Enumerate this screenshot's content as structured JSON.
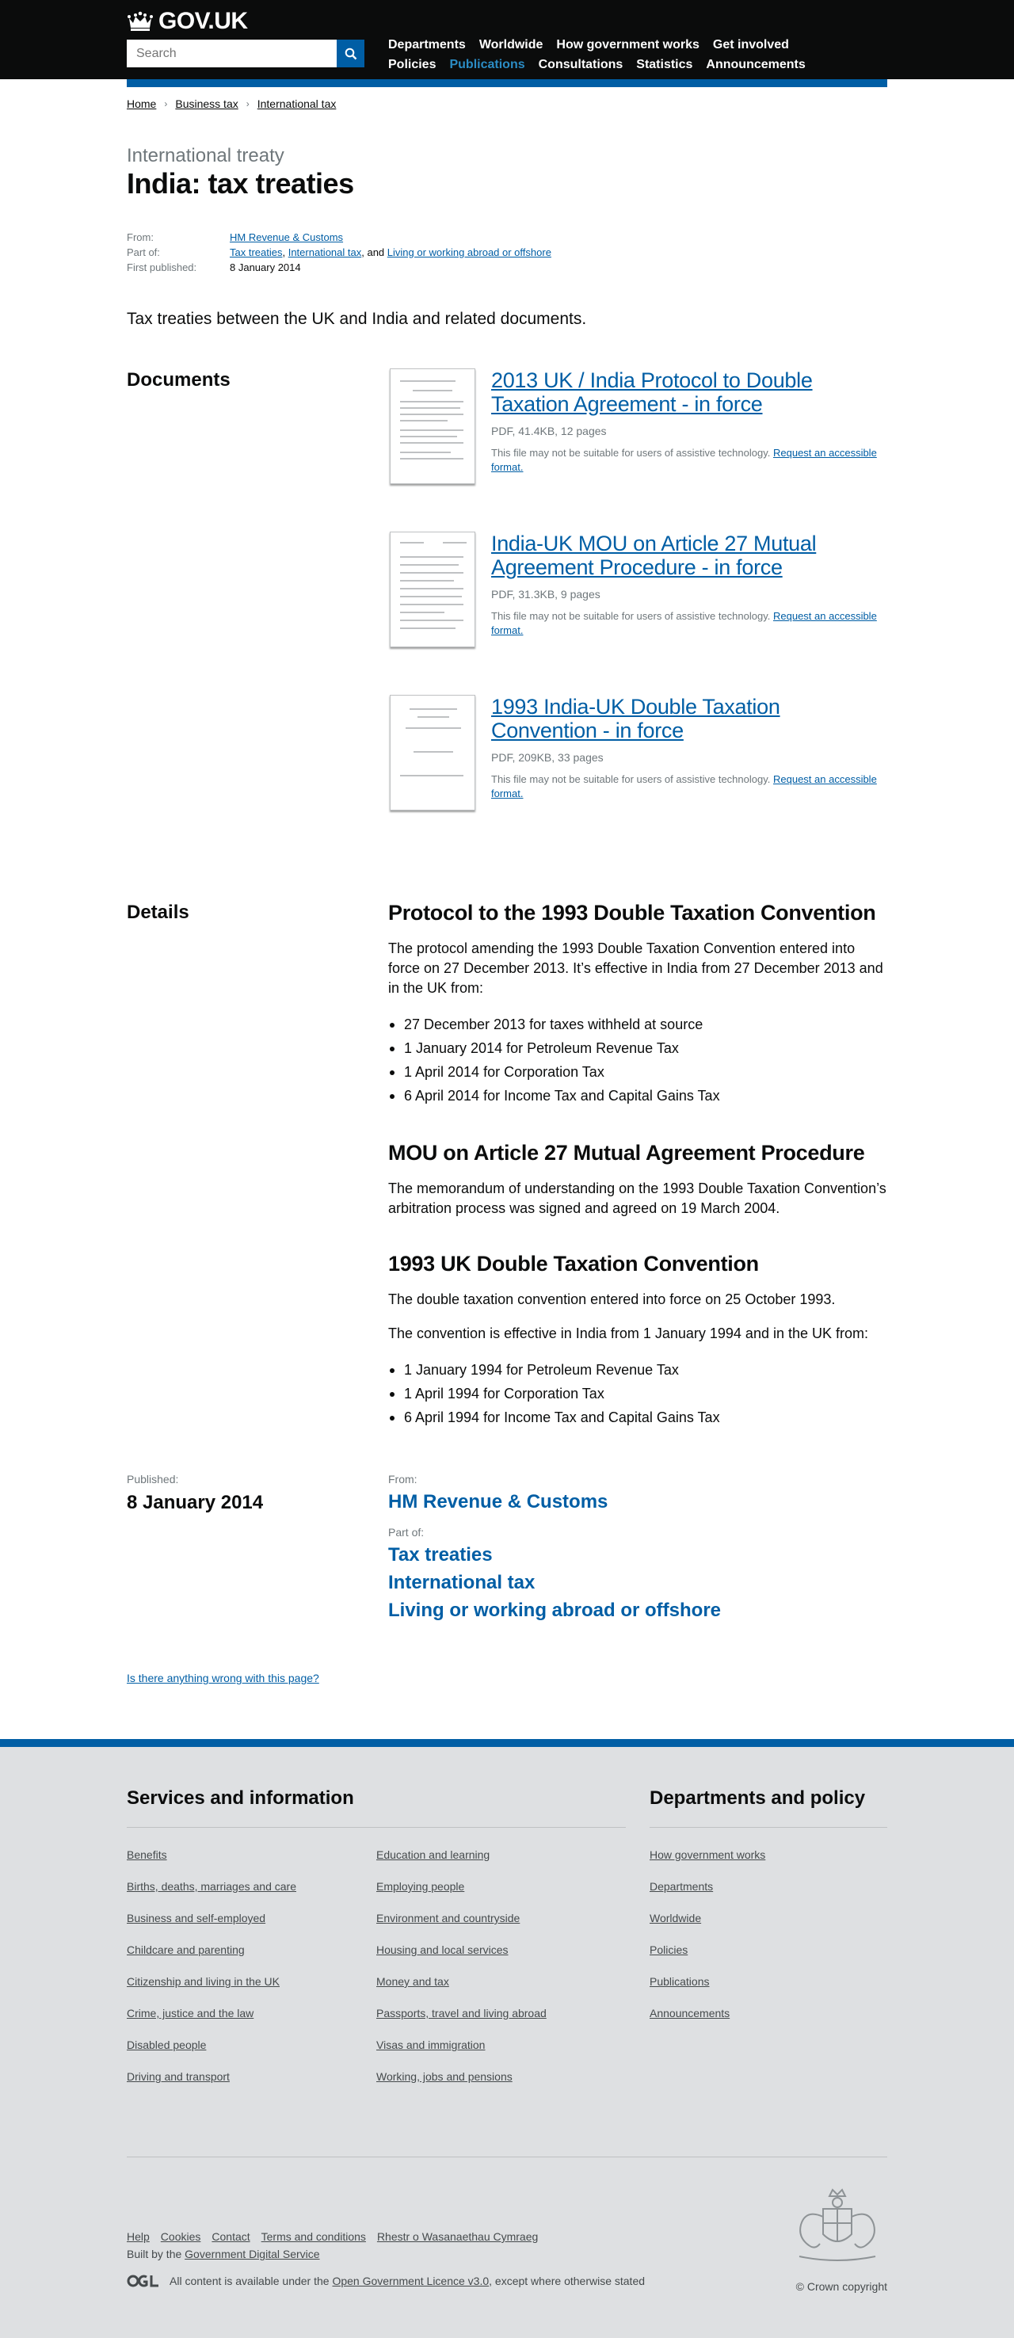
{
  "header": {
    "logo_text": "GOV.UK",
    "search_placeholder": "Search",
    "nav_row1": [
      "Departments",
      "Worldwide",
      "How government works",
      "Get involved"
    ],
    "nav_row2": [
      "Policies",
      "Publications",
      "Consultations",
      "Statistics",
      "Announcements"
    ],
    "active_nav": "Publications"
  },
  "breadcrumbs": [
    "Home",
    "Business tax",
    "International tax"
  ],
  "page": {
    "context": "International treaty",
    "title": "India: tax treaties",
    "meta": {
      "from_label": "From:",
      "from_value": "HM Revenue & Customs",
      "partof_label": "Part of:",
      "partof_links": [
        "Tax treaties",
        "International tax",
        "Living or working abroad or offshore"
      ],
      "partof_sep1": ", ",
      "partof_sep2": ", and ",
      "published_label": "First published:",
      "published_value": "8 January 2014"
    },
    "lead": "Tax treaties between the UK and India and related documents."
  },
  "documents": {
    "heading": "Documents",
    "items": [
      {
        "title": "2013 UK / India Protocol to Double Taxation Agreement - in force",
        "meta": "PDF, 41.4KB, 12 pages",
        "note": "This file may not be suitable for users of assistive technology.",
        "note_link": "Request an accessible format."
      },
      {
        "title": "India-UK MOU on Article 27 Mutual Agreement Procedure - in force",
        "meta": "PDF, 31.3KB, 9 pages",
        "note": "This file may not be suitable for users of assistive technology.",
        "note_link": "Request an accessible format."
      },
      {
        "title": "1993 India-UK Double Taxation Convention - in force",
        "meta": "PDF, 209KB, 33 pages",
        "note": "This file may not be suitable for users of assistive technology.",
        "note_link": "Request an accessible format."
      }
    ]
  },
  "details": {
    "heading": "Details",
    "s1": {
      "title": "Protocol to the 1993 Double Taxation Convention",
      "para": "The protocol amending the 1993 Double Taxation Convention entered into force on 27 December 2013. It’s effective in India from 27 December 2013 and in the UK from:",
      "bullets": [
        "27 December 2013 for taxes withheld at source",
        "1 January 2014 for Petroleum Revenue Tax",
        "1 April 2014 for Corporation Tax",
        "6 April 2014 for Income Tax and Capital Gains Tax"
      ]
    },
    "s2": {
      "title": "MOU on Article 27 Mutual Agreement Procedure",
      "para": "The memorandum of understanding on the 1993 Double Taxation Convention’s arbitration process was signed and agreed on 19 March 2004."
    },
    "s3": {
      "title": "1993 UK Double Taxation Convention",
      "para1": "The double taxation convention entered into force on 25 October 1993.",
      "para2": "The convention is effective in India from 1 January 1994 and in the UK from:",
      "bullets": [
        "1 January 1994 for Petroleum Revenue Tax",
        "1 April 1994 for Corporation Tax",
        "6 April 1994 for Income Tax and Capital Gains Tax"
      ]
    }
  },
  "published": {
    "label": "Published:",
    "date": "8 January 2014",
    "from_label": "From:",
    "from_value": "HM Revenue & Customs",
    "partof_label": "Part of:",
    "partof_links": [
      "Tax treaties",
      "International tax",
      "Living or working abroad or offshore"
    ]
  },
  "report_link": "Is there anything wrong with this page?",
  "footer": {
    "services_heading": "Services and information",
    "depts_heading": "Departments and policy",
    "services_col1": [
      "Benefits",
      "Births, deaths, marriages and care",
      "Business and self-employed",
      "Childcare and parenting",
      "Citizenship and living in the UK",
      "Crime, justice and the law",
      "Disabled people",
      "Driving and transport"
    ],
    "services_col2": [
      "Education and learning",
      "Employing people",
      "Environment and countryside",
      "Housing and local services",
      "Money and tax",
      "Passports, travel and living abroad",
      "Visas and immigration",
      "Working, jobs and pensions"
    ],
    "depts_links": [
      "How government works",
      "Departments",
      "Worldwide",
      "Policies",
      "Publications",
      "Announcements"
    ],
    "meta_links": [
      "Help",
      "Cookies",
      "Contact",
      "Terms and conditions",
      "Rhestr o Wasanaethau Cymraeg"
    ],
    "built_prefix": "Built by the ",
    "built_link": "Government Digital Service",
    "licence_prefix": "All content is available under the ",
    "licence_link": "Open Government Licence v3.0",
    "licence_suffix": ", except where otherwise stated",
    "copyright": "© Crown copyright"
  },
  "colors": {
    "header_bg": "#0b0c0c",
    "link": "#005ea5",
    "accent_bar": "#005ea5",
    "active_nav": "#2b8cc4",
    "footer_bg": "#dee0e2",
    "secondary_text": "#6f777b"
  }
}
